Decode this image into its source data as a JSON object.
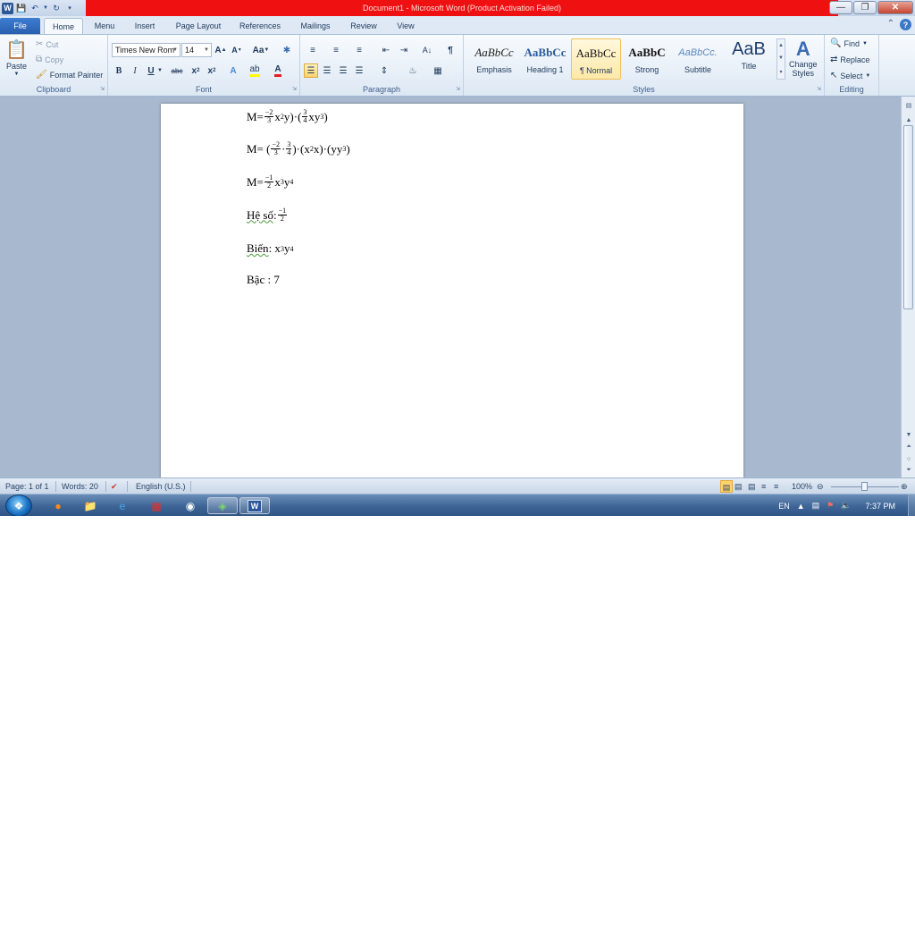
{
  "titlebar": {
    "title": "Document1  -  Microsoft Word (Product Activation Failed)",
    "word_logo": "W"
  },
  "tabs": [
    "File",
    "Home",
    "Menu",
    "Insert",
    "Page Layout",
    "References",
    "Mailings",
    "Review",
    "View"
  ],
  "ribbon": {
    "clipboard": {
      "paste": "Paste",
      "cut": "Cut",
      "copy": "Copy",
      "format_painter": "Format Painter",
      "label": "Clipboard"
    },
    "font": {
      "name": "Times New Rom",
      "size": "14",
      "label": "Font",
      "change_case": "Aa",
      "strike": "abc"
    },
    "paragraph": {
      "label": "Paragraph"
    },
    "styles": {
      "label": "Styles",
      "items": [
        {
          "sample": "AaBbCc",
          "name": "Emphasis"
        },
        {
          "sample": "AaBbCc",
          "name": "Heading 1"
        },
        {
          "sample": "AaBbCc",
          "name": "¶ Normal"
        },
        {
          "sample": "AaBbC",
          "name": "Strong"
        },
        {
          "sample": "AaBbCc.",
          "name": "Subtitle"
        },
        {
          "sample": "AaB",
          "name": "Title"
        }
      ],
      "change_styles_1": "Change",
      "change_styles_2": "Styles"
    },
    "editing": {
      "find": "Find",
      "replace": "Replace",
      "select": "Select",
      "label": "Editing"
    }
  },
  "document": {
    "line1": {
      "prefix": "M= ",
      "f1_num": "−2",
      "f1_den": "3",
      "t1": "x",
      "t1_sup": "2",
      "t2": "y)·(",
      "f2_num": "3",
      "f2_den": "4",
      "t3": "xy",
      "t3_sup": "3",
      "t4": ")"
    },
    "line2": {
      "prefix": "M= (",
      "f1_num": "−2",
      "f1_den": "3",
      "dot": "·",
      "f2_num": "3",
      "f2_den": "4",
      "t1": ")·(x",
      "t1_sup": "2",
      "t2": "x)·(yy",
      "t2_sup": "3",
      "t3": ")"
    },
    "line3": {
      "prefix": "M= ",
      "f_num": "−1",
      "f_den": "2",
      "t1": "x",
      "t1_sup": "3",
      "t2": "y",
      "t2_sup": "4"
    },
    "line4": {
      "label": "Hệ số",
      "sep": " : ",
      "f_num": "−1",
      "f_den": "2"
    },
    "line5": {
      "label": "Biến",
      "sep": " : x",
      "sup1": "3",
      "t": "y",
      "sup2": "4"
    },
    "line6": {
      "text": "Bậc : 7"
    }
  },
  "statusbar": {
    "page": "Page: 1 of 1",
    "words": "Words: 20",
    "language": "English (U.S.)",
    "zoom": "100%"
  },
  "taskbar": {
    "lang": "EN",
    "time": "7:37 PM"
  }
}
